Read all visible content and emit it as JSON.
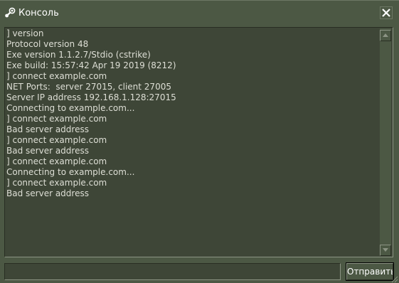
{
  "window": {
    "title": "Консоль",
    "icon": "steam-icon",
    "close_icon": "close-icon"
  },
  "console": {
    "lines": [
      "] version",
      "Protocol version 48",
      "Exe version 1.1.2.7/Stdio (cstrike)",
      "Exe build: 15:57:42 Apr 19 2019 (8212)",
      "] connect example.com",
      "NET Ports:  server 27015, client 27005",
      "Server IP address 192.168.1.128:27015",
      "Connecting to example.com...",
      "] connect example.com",
      "Bad server address",
      "] connect example.com",
      "Bad server address",
      "] connect example.com",
      "Connecting to example.com...",
      "] connect example.com",
      "Bad server address"
    ]
  },
  "input": {
    "value": "",
    "placeholder": ""
  },
  "submit": {
    "label": "Отправить"
  },
  "colors": {
    "window_bg": "#4c5844",
    "panel_bg": "#3e4637",
    "text": "#dedfd6",
    "title_text": "#ffffff"
  }
}
